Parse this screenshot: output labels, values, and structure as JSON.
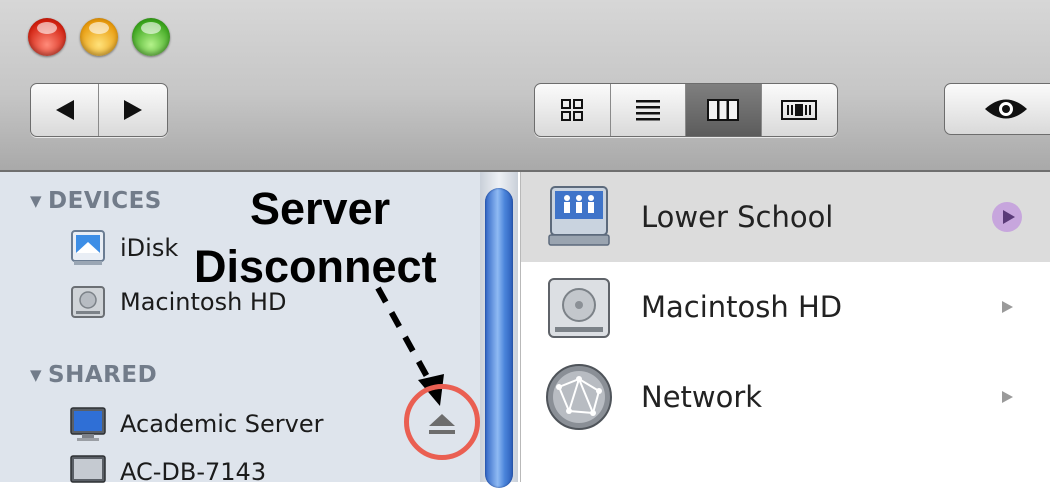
{
  "toolbar": {
    "traffic_lights": [
      "close",
      "minimize",
      "zoom"
    ],
    "nav_buttons": [
      "back",
      "forward"
    ],
    "view_buttons": [
      "icon-view",
      "list-view",
      "column-view",
      "cover-flow-view"
    ],
    "active_view": "column-view",
    "quick_look": "eye-icon"
  },
  "sidebar": {
    "devices_header": "DEVICES",
    "devices": [
      {
        "label": "iDisk",
        "icon": "idisk-icon"
      },
      {
        "label": "Macintosh HD",
        "icon": "hard-drive-icon"
      }
    ],
    "shared_header": "SHARED",
    "shared": [
      {
        "label": "Academic Server",
        "icon": "monitor-icon"
      },
      {
        "label": "AC-DB-7143",
        "icon": "monitor-icon"
      }
    ]
  },
  "annotation": {
    "line1": "Server",
    "line2": "Disconnect",
    "circle_color": "#ea5f52"
  },
  "column": {
    "items": [
      {
        "label": "Lower School",
        "icon": "server-share-icon",
        "selected": true
      },
      {
        "label": "Macintosh HD",
        "icon": "hard-drive-icon",
        "selected": false
      },
      {
        "label": "Network",
        "icon": "network-globe-icon",
        "selected": false
      }
    ]
  },
  "colors": {
    "sidebar_bg": "#dee4ec",
    "selection_bg": "#dcdcdc",
    "scroll_thumb": "#4b85db"
  }
}
